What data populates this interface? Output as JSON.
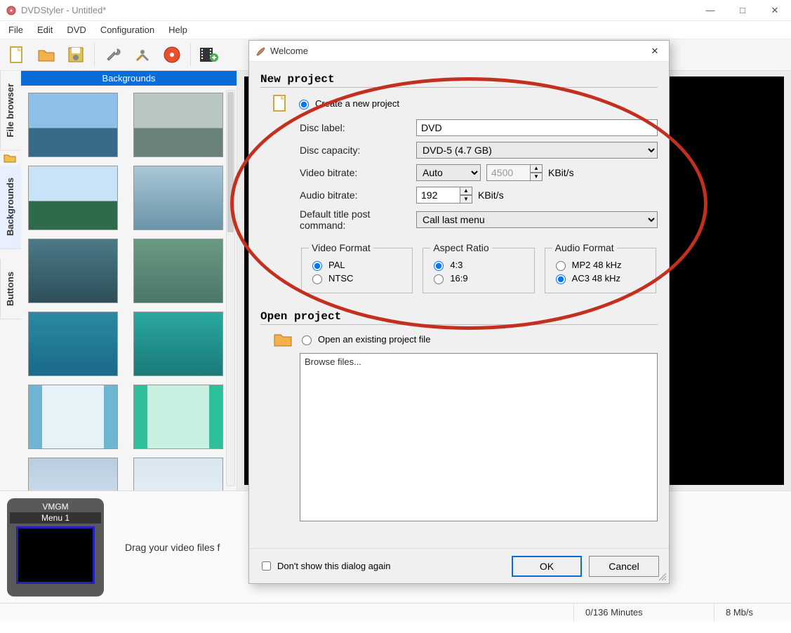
{
  "window": {
    "title": "DVDStyler - Untitled*",
    "minimize": "—",
    "maximize": "□",
    "close": "✕"
  },
  "menu": {
    "items": [
      "File",
      "Edit",
      "DVD",
      "Configuration",
      "Help"
    ]
  },
  "tabs": {
    "file_browser": "File browser",
    "backgrounds": "Backgrounds",
    "buttons": "Buttons"
  },
  "side_header": "Backgrounds",
  "bg_colors_a": [
    "#6fa8c7",
    "#a8b9be",
    "#7bb3e0",
    "#9fbfd0",
    "#3a6f7a",
    "#5a9a88",
    "#2f8a8a",
    "#3dbfb0",
    "#6db5d0",
    "#2fbf9a",
    "#b8cde0",
    "#d8e6ef"
  ],
  "timeline": {
    "vmgm_label": "VMGM",
    "menu_label": "Menu 1",
    "drag_hint": "Drag your video files f"
  },
  "status": {
    "minutes": "0/136 Minutes",
    "bitrate": "8 Mb/s"
  },
  "dialog": {
    "title": "Welcome",
    "new_project_heading": "New project",
    "create_label": "Create a new project",
    "disc_label_lbl": "Disc label:",
    "disc_label_val": "DVD",
    "capacity_lbl": "Disc capacity:",
    "capacity_val": "DVD-5 (4.7 GB)",
    "vbitrate_lbl": "Video bitrate:",
    "vbitrate_mode": "Auto",
    "vbitrate_val": "4500",
    "vbitrate_unit": "KBit/s",
    "abitrate_lbl": "Audio bitrate:",
    "abitrate_val": "192",
    "abitrate_unit": "KBit/s",
    "post_lbl": "Default title post command:",
    "post_val": "Call last menu",
    "fs_video": "Video Format",
    "fs_video_pal": "PAL",
    "fs_video_ntsc": "NTSC",
    "fs_ar": "Aspect Ratio",
    "fs_ar_43": "4:3",
    "fs_ar_169": "16:9",
    "fs_audio": "Audio Format",
    "fs_audio_mp2": "MP2 48 kHz",
    "fs_audio_ac3": "AC3 48 kHz",
    "open_heading": "Open project",
    "open_label": "Open an existing project file",
    "browse_hint": "Browse files...",
    "dontshow": "Don't show this dialog again",
    "ok": "OK",
    "cancel": "Cancel",
    "close": "✕"
  }
}
